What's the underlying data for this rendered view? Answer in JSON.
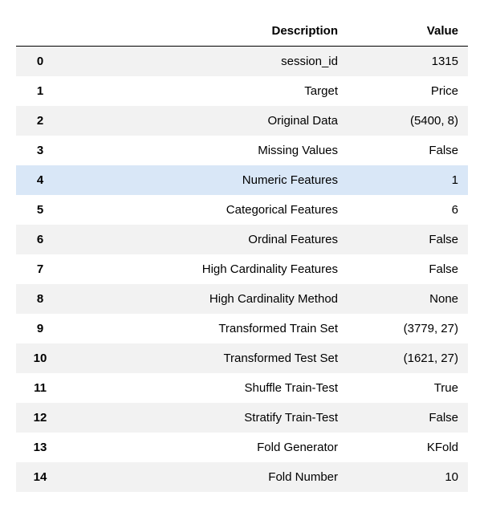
{
  "headers": {
    "index": "",
    "description": "Description",
    "value": "Value"
  },
  "highlight_index": 4,
  "rows": [
    {
      "idx": "0",
      "description": "session_id",
      "value": "1315"
    },
    {
      "idx": "1",
      "description": "Target",
      "value": "Price"
    },
    {
      "idx": "2",
      "description": "Original Data",
      "value": "(5400, 8)"
    },
    {
      "idx": "3",
      "description": "Missing Values",
      "value": "False"
    },
    {
      "idx": "4",
      "description": "Numeric Features",
      "value": "1"
    },
    {
      "idx": "5",
      "description": "Categorical Features",
      "value": "6"
    },
    {
      "idx": "6",
      "description": "Ordinal Features",
      "value": "False"
    },
    {
      "idx": "7",
      "description": "High Cardinality Features",
      "value": "False"
    },
    {
      "idx": "8",
      "description": "High Cardinality Method",
      "value": "None"
    },
    {
      "idx": "9",
      "description": "Transformed Train Set",
      "value": "(3779, 27)"
    },
    {
      "idx": "10",
      "description": "Transformed Test Set",
      "value": "(1621, 27)"
    },
    {
      "idx": "11",
      "description": "Shuffle Train-Test",
      "value": "True"
    },
    {
      "idx": "12",
      "description": "Stratify Train-Test",
      "value": "False"
    },
    {
      "idx": "13",
      "description": "Fold Generator",
      "value": "KFold"
    },
    {
      "idx": "14",
      "description": "Fold Number",
      "value": "10"
    }
  ]
}
